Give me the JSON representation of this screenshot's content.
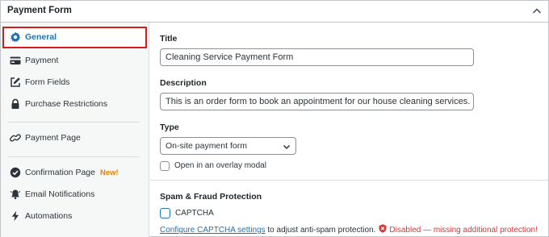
{
  "panel": {
    "title": "Payment Form",
    "collapse_icon": "chevron-up-icon"
  },
  "sidebar": {
    "items": [
      {
        "label": "General",
        "icon": "gear-icon",
        "active": true
      },
      {
        "label": "Payment",
        "icon": "credit-card-icon"
      },
      {
        "label": "Form Fields",
        "icon": "edit-icon"
      },
      {
        "label": "Purchase Restrictions",
        "icon": "lock-icon"
      },
      {
        "label": "Payment Page",
        "icon": "link-icon"
      },
      {
        "label": "Confirmation Page",
        "icon": "check-circle-icon",
        "badge": "New!"
      },
      {
        "label": "Email Notifications",
        "icon": "bell-icon"
      },
      {
        "label": "Automations",
        "icon": "lightning-icon"
      }
    ]
  },
  "general": {
    "title_label": "Title",
    "title_value": "Cleaning Service Payment Form",
    "description_label": "Description",
    "description_value": "This is an order form to book an appointment for our house cleaning services.",
    "type_label": "Type",
    "type_value": "On-site payment form",
    "overlay_label": "Open in an overlay modal",
    "overlay_checked": false
  },
  "spam": {
    "heading": "Spam & Fraud Protection",
    "captcha_label": "CAPTCHA",
    "captcha_checked": false,
    "help_link": "Configure CAPTCHA settings",
    "help_text": " to adjust anti-spam protection.",
    "warning_text": "Disabled — missing additional protection!"
  },
  "colors": {
    "accent": "#2271b1",
    "highlight": "#d61b1b",
    "new_badge": "#e68100",
    "warning": "#d63638"
  }
}
